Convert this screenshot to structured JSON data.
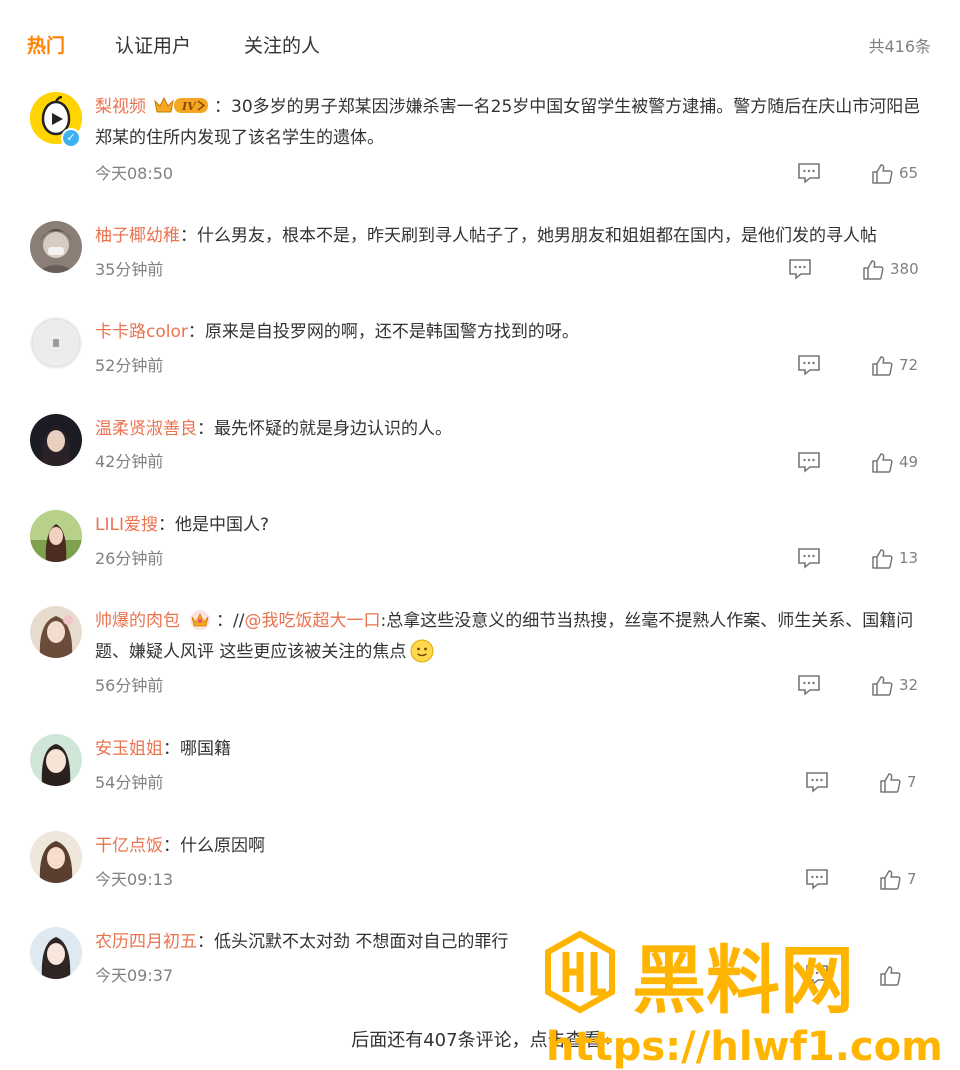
{
  "tabs": [
    {
      "label": "热门"
    },
    {
      "label": "认证用户"
    },
    {
      "label": "关注的人"
    }
  ],
  "total": "共416条",
  "comments": [
    {
      "user": "梨视频",
      "colon": "：",
      "text": "30多岁的男子郑某因涉嫌杀害一名25岁中国女留学生被警方逮捕。警方随后在庆山市河阳邑郑某的住所内发现了该名学生的遗体。",
      "time": "今天08:50",
      "likes": "65"
    },
    {
      "user": "柚子椰幼稚",
      "colon": "：",
      "text": "什么男友，根本不是，昨天刷到寻人帖子了，她男朋友和姐姐都在国内，是他们发的寻人帖",
      "time": "35分钟前",
      "likes": "380"
    },
    {
      "user": "卡卡路color",
      "colon": "：",
      "text": "原来是自投罗网的啊，还不是韩国警方找到的呀。",
      "time": "52分钟前",
      "likes": "72"
    },
    {
      "user": "温柔贤淑善良",
      "colon": "：",
      "text": "最先怀疑的就是身边认识的人。",
      "time": "42分钟前",
      "likes": "49"
    },
    {
      "user": "LILI爱搜",
      "colon": "：",
      "text": "他是中国人?",
      "time": "26分钟前",
      "likes": "13"
    },
    {
      "user": "帅爆的肉包",
      "colon": "：",
      "prefix": "//",
      "mention": "@我吃饭超大一口",
      "text": ":总拿这些没意义的细节当热搜，丝毫不提熟人作案、师生关系、国籍问题、嫌疑人风评 这些更应该被关注的焦点",
      "time": "56分钟前",
      "likes": "32"
    },
    {
      "user": "安玉姐姐",
      "colon": "：",
      "text": "哪国籍",
      "time": "54分钟前",
      "likes": "7"
    },
    {
      "user": "干亿点饭",
      "colon": "：",
      "text": "什么原因啊",
      "time": "今天09:13",
      "likes": "7"
    },
    {
      "user": "农历四月初五",
      "colon": "：",
      "text": "低头沉默不太对劲 不想面对自己的罪行",
      "time": "今天09:37",
      "likes": ""
    }
  ],
  "more_link": "后面还有407条评论，点击查看",
  "more_arrow": "›",
  "watermark": {
    "title": "黑料网",
    "url": "https://hlwf1.com"
  },
  "colors": {
    "accent": "#ff8200",
    "username": "#eb7350",
    "meta": "#808080",
    "watermark": "#ffb400"
  },
  "icons": {
    "reply": "comment-icon",
    "like": "thumbs-up-icon",
    "more": "chevron-right-icon",
    "verified": "check-badge-icon"
  }
}
